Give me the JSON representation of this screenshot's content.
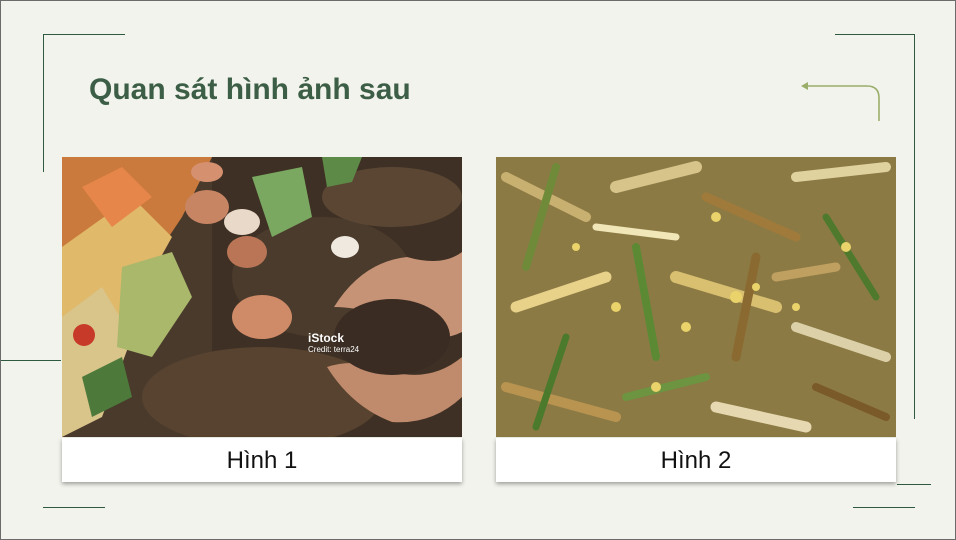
{
  "slide": {
    "title": "Quan sát hình ảnh sau",
    "images": [
      {
        "caption": "Hình 1",
        "icon": "compost-soil-photo",
        "watermark": "iStock",
        "credit": "Credit: terra24"
      },
      {
        "caption": "Hình 2",
        "icon": "chopped-plant-material-photo"
      }
    ]
  },
  "colors": {
    "background": "#f2f3ec",
    "title": "#3d5e46",
    "frame_lines": "#2f5a40",
    "arrow": "#9aae6a"
  }
}
